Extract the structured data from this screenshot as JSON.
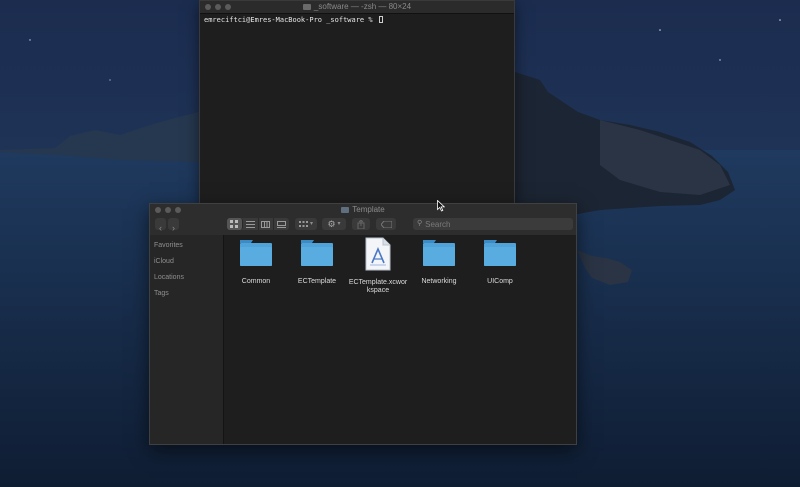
{
  "colors": {
    "folder_body": "#4fa3d8",
    "folder_tab": "#3d8bc4",
    "window_bg": "#1e1e1e"
  },
  "terminal": {
    "title": "_software — -zsh — 80×24",
    "prompt": "emreciftci@Emres-MacBook-Pro _software % "
  },
  "finder": {
    "title": "Template",
    "search_placeholder": "Search",
    "sidebar": [
      {
        "label": "Favorites"
      },
      {
        "label": "iCloud"
      },
      {
        "label": "Locations"
      },
      {
        "label": "Tags"
      }
    ],
    "items": [
      {
        "name": "Common",
        "icon": "folder-icon"
      },
      {
        "name": "ECTemplate",
        "icon": "folder-icon"
      },
      {
        "name": "ECTemplate.xcworkspace",
        "icon": "xcode-workspace-icon"
      },
      {
        "name": "Networking",
        "icon": "folder-icon"
      },
      {
        "name": "UIComp",
        "icon": "folder-icon"
      }
    ]
  }
}
